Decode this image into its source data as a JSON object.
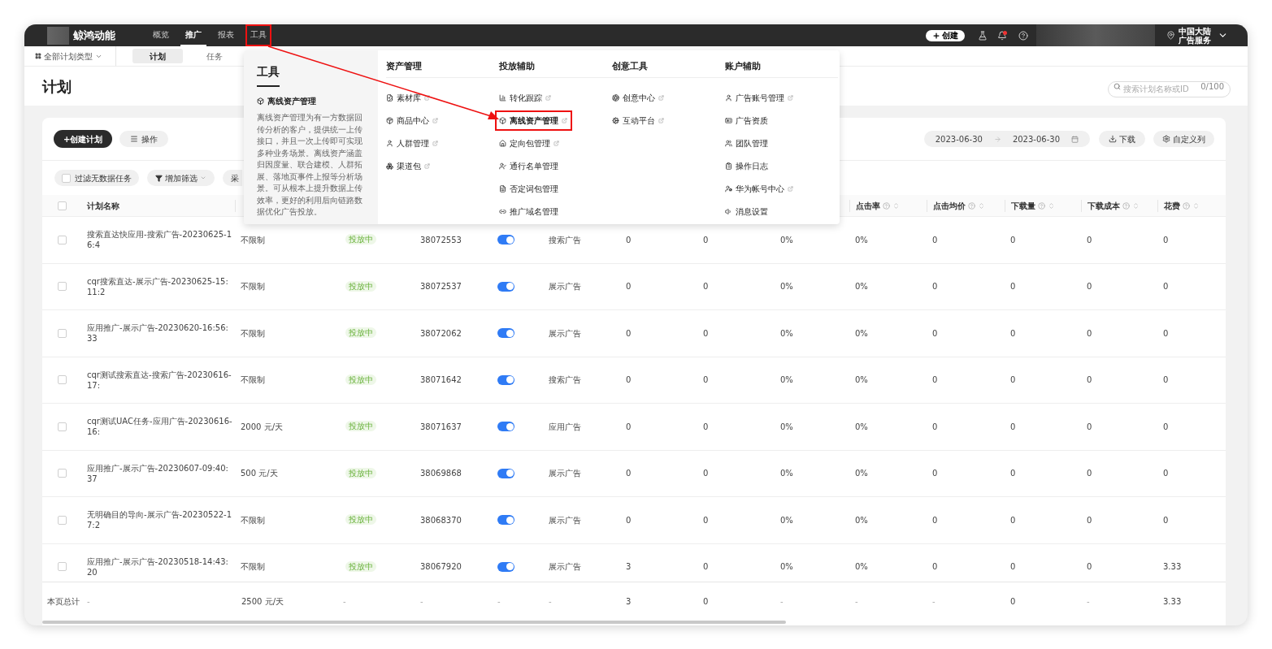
{
  "brand": {
    "name": "鲸鸿动能"
  },
  "nav": [
    {
      "label": "概览",
      "selected": false,
      "highlighted": false
    },
    {
      "label": "推广",
      "selected": true,
      "highlighted": false
    },
    {
      "label": "报表",
      "selected": false,
      "highlighted": false
    },
    {
      "label": "工具",
      "selected": false,
      "highlighted": true
    }
  ],
  "top_right": {
    "create_button": "创建",
    "notification_dot": true,
    "region_line1": "中国大陆",
    "region_line2": "广告服务"
  },
  "subbar": {
    "type_filter": "全部计划类型",
    "tabs": [
      {
        "label": "计划",
        "selected": true
      },
      {
        "label": "任务",
        "selected": false
      }
    ]
  },
  "page_title": "计划",
  "search": {
    "placeholder": "搜索计划名称或ID",
    "counter": "0/100"
  },
  "toolbar": {
    "create_button": "+创建计划",
    "ops_button": "操作",
    "date_from": "2023-06-30",
    "date_to": "2023-06-30",
    "download_button": "下载",
    "columns_button": "自定义列"
  },
  "filters": {
    "no_data_label": "过滤无数据任务",
    "no_data_checked": false,
    "add_filter": "增加筛选",
    "cut_filter": "采"
  },
  "table": {
    "select_all_checked": false,
    "name_header": "计划名称",
    "metric_headers": [
      "点击率",
      "点击均价",
      "下载量",
      "下载成本",
      "花费"
    ],
    "rows": [
      {
        "checked": false,
        "name": "搜索直达快应用-搜索广告-20230625-16:4",
        "budget": "不限制",
        "status": "投放中",
        "id": "38072553",
        "on": true,
        "type": "搜索广告",
        "metrics": [
          "0",
          "0",
          "0%",
          "0%",
          "0",
          "0",
          "0",
          "0"
        ]
      },
      {
        "checked": false,
        "name": "cqr搜索直达-展示广告-20230625-15:11:2",
        "budget": "不限制",
        "status": "投放中",
        "id": "38072537",
        "on": true,
        "type": "展示广告",
        "metrics": [
          "0",
          "0",
          "0%",
          "0%",
          "0",
          "0",
          "0",
          "0"
        ]
      },
      {
        "checked": false,
        "name": "应用推广-展示广告-20230620-16:56:33",
        "budget": "不限制",
        "status": "投放中",
        "id": "38072062",
        "on": true,
        "type": "展示广告",
        "metrics": [
          "0",
          "0",
          "0%",
          "0%",
          "0",
          "0",
          "0",
          "0"
        ]
      },
      {
        "checked": false,
        "name": "cqr测试搜索直达-搜索广告-20230616-17:",
        "budget": "不限制",
        "status": "投放中",
        "id": "38071642",
        "on": true,
        "type": "搜索广告",
        "metrics": [
          "0",
          "0",
          "0%",
          "0%",
          "0",
          "0",
          "0",
          "0"
        ]
      },
      {
        "checked": false,
        "name": "cqr测试UAC任务-应用广告-20230616-16:",
        "budget": "2000 元/天",
        "status": "投放中",
        "id": "38071637",
        "on": true,
        "type": "应用广告",
        "metrics": [
          "0",
          "0",
          "0%",
          "0%",
          "0",
          "0",
          "0",
          "0"
        ]
      },
      {
        "checked": false,
        "name": "应用推广-展示广告-20230607-09:40:37",
        "budget": "500 元/天",
        "status": "投放中",
        "id": "38069868",
        "on": true,
        "type": "展示广告",
        "metrics": [
          "0",
          "0",
          "0%",
          "0%",
          "0",
          "0",
          "0",
          "0"
        ]
      },
      {
        "checked": false,
        "name": "无明确目的导向-展示广告-20230522-17:2",
        "budget": "不限制",
        "status": "投放中",
        "id": "38068370",
        "on": true,
        "type": "展示广告",
        "metrics": [
          "0",
          "0",
          "0%",
          "0%",
          "0",
          "0",
          "0",
          "0"
        ]
      },
      {
        "checked": false,
        "name": "应用推广-展示广告-20230518-14:43:20",
        "budget": "不限制",
        "status": "投放中",
        "id": "38067920",
        "on": true,
        "type": "展示广告",
        "metrics": [
          "3",
          "0",
          "0%",
          "0%",
          "0",
          "0",
          "0",
          "3.33"
        ]
      }
    ],
    "summary": [
      "本页总计",
      "-",
      "2500 元/天",
      "-",
      "-",
      "-",
      "-",
      "3",
      "0",
      "-",
      "-",
      "-",
      "0",
      "-",
      "3.33"
    ]
  },
  "tools_menu": {
    "title": "工具",
    "feature_title": "离线资产管理",
    "feature_text": "离线资产管理为有一方数据回传分析的客户，提供统一上传接口，并且一次上传即可实现多种业务场景。离线资产涵盖归因度量、联合建模、人群拓展、落地页事件上报等分析场景。可从根本上提升数据上传效率，更好的利用后向链路数据优化广告投放。",
    "columns": [
      {
        "title": "资产管理",
        "items": [
          {
            "label": "素材库",
            "external": true,
            "highlighted": false
          },
          {
            "label": "商品中心",
            "external": true,
            "highlighted": false
          },
          {
            "label": "人群管理",
            "external": true,
            "highlighted": false
          },
          {
            "label": "渠道包",
            "external": true,
            "highlighted": false
          }
        ]
      },
      {
        "title": "投放辅助",
        "items": [
          {
            "label": "转化跟踪",
            "external": true,
            "highlighted": false
          },
          {
            "label": "离线资产管理",
            "external": true,
            "highlighted": true
          },
          {
            "label": "定向包管理",
            "external": true,
            "highlighted": false
          },
          {
            "label": "通行名单管理",
            "external": false,
            "highlighted": false
          },
          {
            "label": "否定词包管理",
            "external": false,
            "highlighted": false
          },
          {
            "label": "推广域名管理",
            "external": false,
            "highlighted": false
          }
        ]
      },
      {
        "title": "创意工具",
        "items": [
          {
            "label": "创意中心",
            "external": true,
            "highlighted": false
          },
          {
            "label": "互动平台",
            "external": true,
            "highlighted": false
          }
        ]
      },
      {
        "title": "账户辅助",
        "items": [
          {
            "label": "广告账号管理",
            "external": true,
            "highlighted": false
          },
          {
            "label": "广告资质",
            "external": false,
            "highlighted": false
          },
          {
            "label": "团队管理",
            "external": false,
            "highlighted": false
          },
          {
            "label": "操作日志",
            "external": false,
            "highlighted": false
          },
          {
            "label": "华为帐号中心",
            "external": true,
            "highlighted": false
          },
          {
            "label": "消息设置",
            "external": false,
            "highlighted": false
          }
        ]
      }
    ]
  }
}
